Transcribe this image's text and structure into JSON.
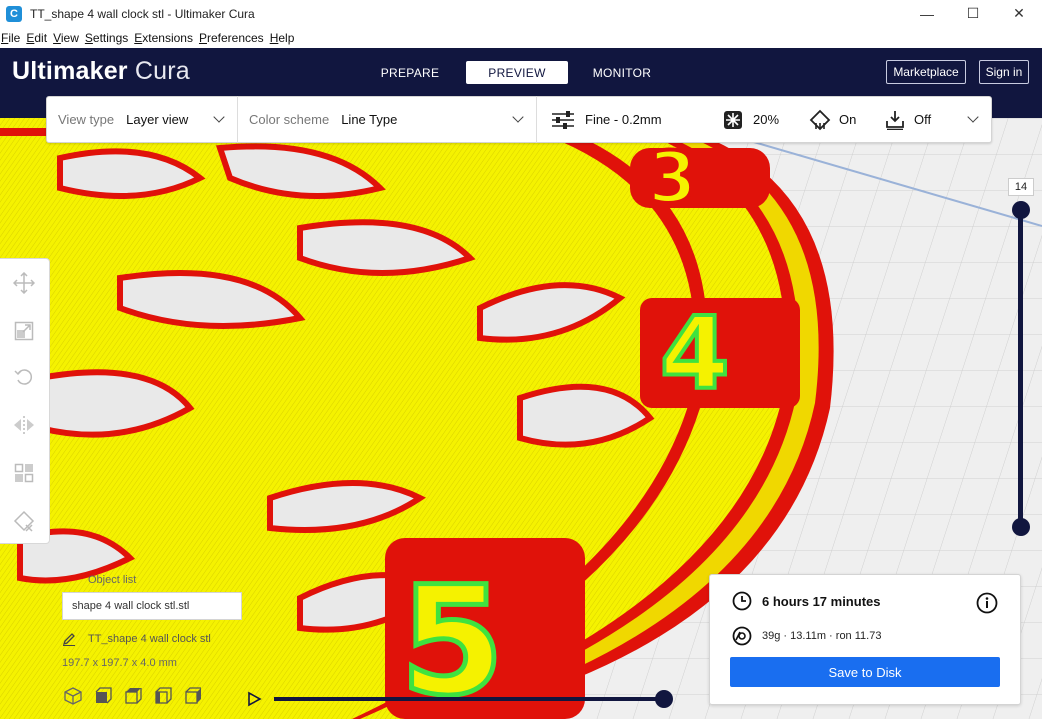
{
  "window": {
    "title": "TT_shape  4 wall clock stl - Ultimaker Cura",
    "app_icon_letter": "C",
    "minimize": "—",
    "maximize": "☐",
    "close": "✕"
  },
  "menu": [
    {
      "u": "F",
      "rest": "ile"
    },
    {
      "u": "E",
      "rest": "dit"
    },
    {
      "u": "V",
      "rest": "iew"
    },
    {
      "u": "S",
      "rest": "ettings"
    },
    {
      "u": "E",
      "rest": "xtensions"
    },
    {
      "u": "P",
      "rest": "references"
    },
    {
      "u": "H",
      "rest": "elp"
    }
  ],
  "header": {
    "logo_bold": "Ultimaker",
    "logo_light": " Cura",
    "tabs": [
      "PREPARE",
      "PREVIEW",
      "MONITOR"
    ],
    "active_tab": "PREVIEW",
    "marketplace": "Marketplace",
    "signin": "Sign in",
    "bg_color": "#11163f"
  },
  "setup_bar": {
    "view_type_label": "View type",
    "view_type_value": "Layer view",
    "color_scheme_label": "Color scheme",
    "color_scheme_value": "Line Type",
    "profile": "Fine - 0.2mm",
    "infill": "20%",
    "support": "On",
    "adhesion": "Off"
  },
  "layer_slider": {
    "current_layer": "14"
  },
  "object_list": {
    "title": "Object list",
    "item": "shape  4 wall clock stl.stl",
    "edit_name": "TT_shape  4 wall clock stl",
    "dims": "197.7 x 197.7 x 4.0 mm"
  },
  "print_info": {
    "time": "6 hours 17 minutes",
    "material": "39g · 13.11m · ron 11.73",
    "save_label": "Save to Disk",
    "save_color": "#196ef0"
  },
  "print_colors": {
    "infill": "#f5f200",
    "wall": "#f0120a",
    "inner_wall": "#3fe23f"
  }
}
